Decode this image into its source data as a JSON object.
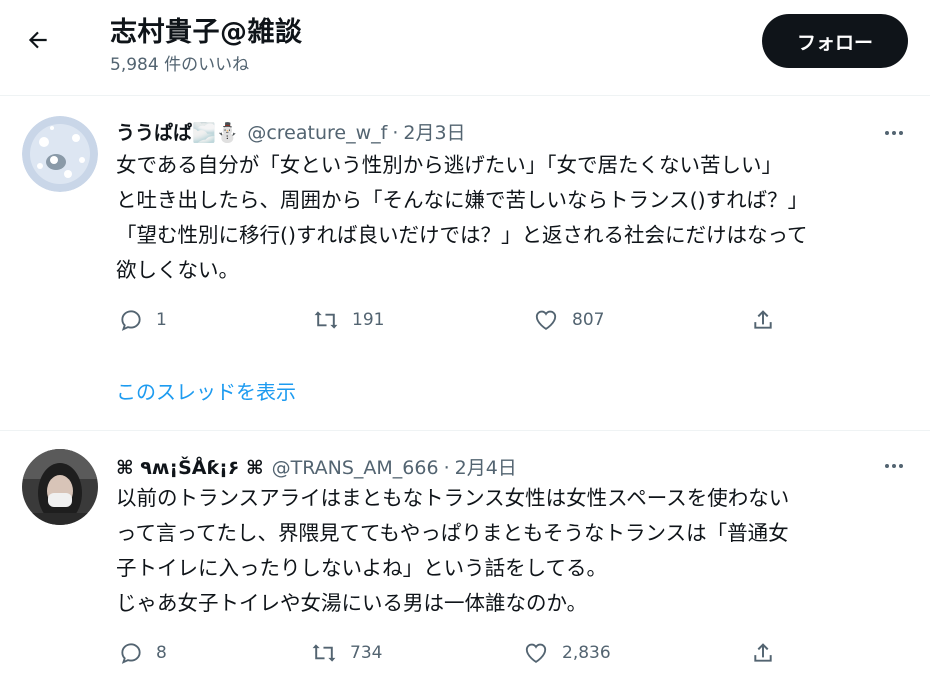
{
  "header": {
    "title": "志村貴子@雑談",
    "subtitle": "5,984 件のいいね",
    "follow_label": "フォロー"
  },
  "tweets": [
    {
      "name": "ううぱぱ🌫️⛄",
      "handle": "@creature_w_f",
      "separator": "·",
      "date": "2月3日",
      "text": "女である自分が「女という性別から逃げたい」「女で居たくない苦しい」\nと吐き出したら、周囲から「そんなに嫌で苦しいならトランス()すれば？」\n「望む性別に移行()すれば良いだけでは？」と返される社会にだけはなって\n欲しくない。",
      "replies": "1",
      "retweets": "191",
      "likes": "807",
      "show_thread": "このスレッドを表示"
    },
    {
      "name": "⌘ ٩ʍ¡ŠÅƙ¡۶ ⌘",
      "handle": "@TRANS_AM_666",
      "separator": "·",
      "date": "2月4日",
      "text": "以前のトランスアライはまともなトランス女性は女性スペースを使わない\nって言ってたし、界隈見ててもやっぱりまともそうなトランスは「普通女\n子トイレに入ったりしないよね」という話をしてる。\nじゃあ女子トイレや女湯にいる男は一体誰なのか。",
      "replies": "8",
      "retweets": "734",
      "likes": "2,836"
    }
  ],
  "icons": {
    "back": "arrow-left-icon",
    "more": "more-dots-icon",
    "reply": "reply-icon",
    "retweet": "retweet-icon",
    "like": "heart-icon",
    "share": "share-icon"
  },
  "colors": {
    "text": "#0f1419",
    "muted": "#536471",
    "link": "#1d9bf0",
    "follow_bg": "#0f1419",
    "border": "#eff3f4"
  }
}
